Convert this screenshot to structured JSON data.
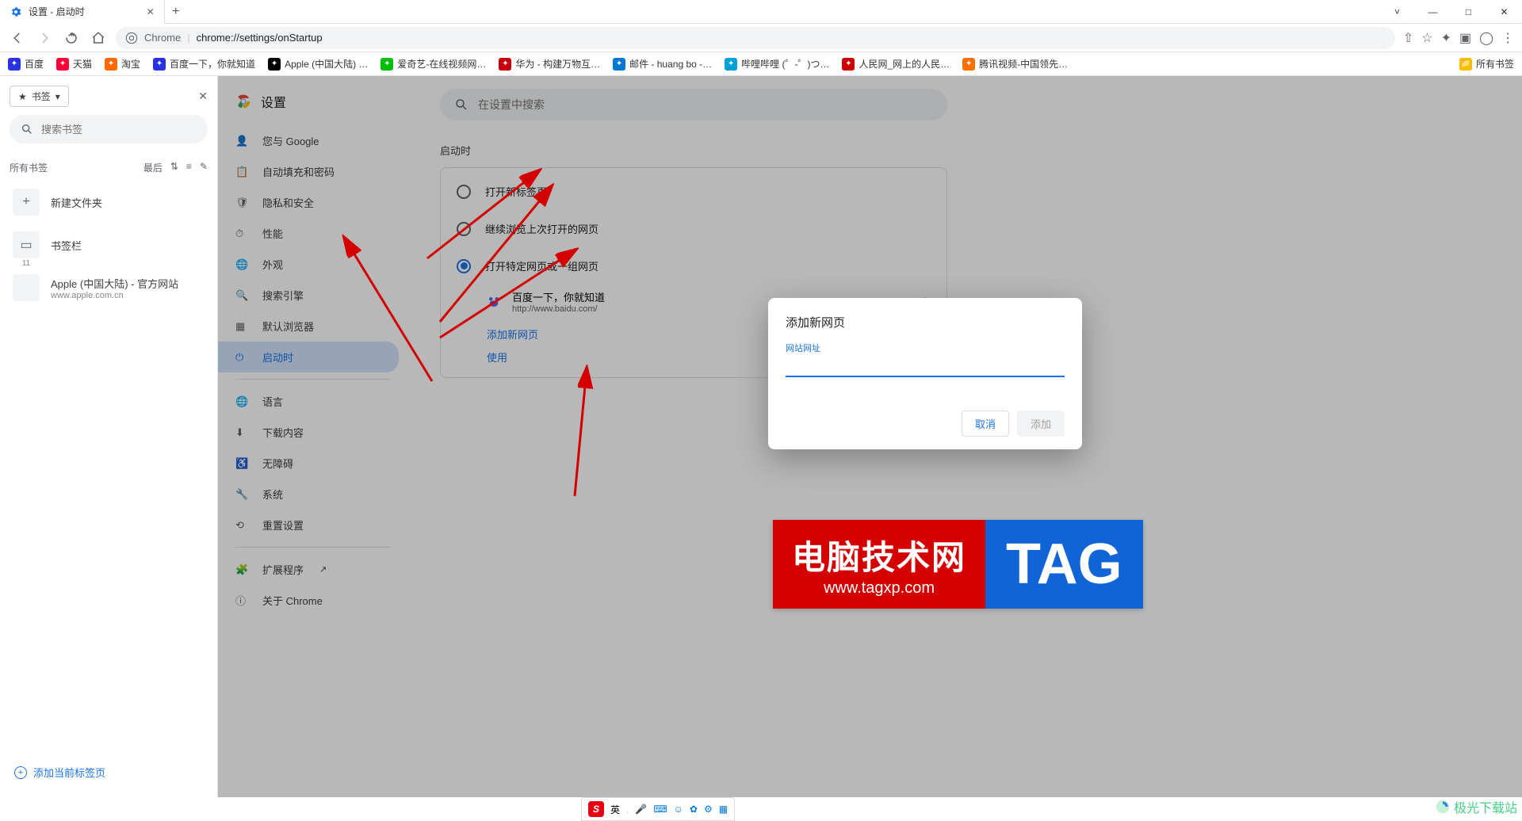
{
  "window": {
    "tab_title": "设置 - 启动时",
    "new_tab_tooltip": "+",
    "min": "—",
    "max": "□",
    "close": "✕"
  },
  "toolbar": {
    "chrome_label": "Chrome",
    "url_prefix": "chrome://",
    "url_path": "settings/onStartup"
  },
  "bookmark_bar": [
    {
      "label": "百度",
      "color": "#2932e1"
    },
    {
      "label": "天猫",
      "color": "#ff0036"
    },
    {
      "label": "淘宝",
      "color": "#ff6a00"
    },
    {
      "label": "百度一下，你就知道",
      "color": "#2932e1"
    },
    {
      "label": "Apple (中国大陆) …",
      "color": "#000"
    },
    {
      "label": "爱奇艺-在线视频网…",
      "color": "#00be06"
    },
    {
      "label": "华为 - 构建万物互…",
      "color": "#c7000b"
    },
    {
      "label": "邮件 - huang bo -…",
      "color": "#0078d4"
    },
    {
      "label": "哔哩哔哩 (゜-゜)つ…",
      "color": "#00a1d6"
    },
    {
      "label": "人民网_网上的人民…",
      "color": "#cc0000"
    },
    {
      "label": "腾讯视频-中国领先…",
      "color": "#ff6f00"
    }
  ],
  "bookmark_bar_all": "所有书签",
  "bm_panel": {
    "chip": "书签",
    "search_placeholder": "搜索书签",
    "all_label": "所有书签",
    "sort_label": "最后",
    "new_folder": "新建文件夹",
    "bar_label": "书签栏",
    "bar_count": "11",
    "apple_title": "Apple (中国大陆) - 官方网站",
    "apple_url": "www.apple.com.cn",
    "footer": "添加当前标签页"
  },
  "settings": {
    "title": "设置",
    "search_placeholder": "在设置中搜索",
    "nav": [
      {
        "icon": "person",
        "label": "您与 Google"
      },
      {
        "icon": "autofill",
        "label": "自动填充和密码"
      },
      {
        "icon": "shield",
        "label": "隐私和安全"
      },
      {
        "icon": "speed",
        "label": "性能"
      },
      {
        "icon": "globe",
        "label": "外观"
      },
      {
        "icon": "search",
        "label": "搜索引擎"
      },
      {
        "icon": "apps",
        "label": "默认浏览器"
      },
      {
        "icon": "power",
        "label": "启动时",
        "active": true
      }
    ],
    "nav2": [
      {
        "icon": "lang",
        "label": "语言"
      },
      {
        "icon": "download",
        "label": "下载内容"
      },
      {
        "icon": "a11y",
        "label": "无障碍"
      },
      {
        "icon": "wrench",
        "label": "系统"
      },
      {
        "icon": "reset",
        "label": "重置设置"
      }
    ],
    "nav3": [
      {
        "icon": "ext",
        "label": "扩展程序",
        "ext": true
      },
      {
        "icon": "about",
        "label": "关于 Chrome"
      }
    ],
    "section_title": "启动时",
    "opt1": "打开新标签页",
    "opt2": "继续浏览上次打开的网页",
    "opt3": "打开特定网页或一组网页",
    "site_title": "百度一下，你就知道",
    "site_url": "http://www.baidu.com/",
    "add_page": "添加新网页",
    "use_current": "使用"
  },
  "dialog": {
    "title": "添加新网页",
    "field_label": "网站网址",
    "value": "",
    "cancel": "取消",
    "add": "添加"
  },
  "watermark": {
    "line1": "电脑技术网",
    "line2": "www.tagxp.com",
    "tag": "TAG"
  },
  "ime": {
    "brand": "S",
    "mode": "英"
  },
  "corner": "极光下载站"
}
